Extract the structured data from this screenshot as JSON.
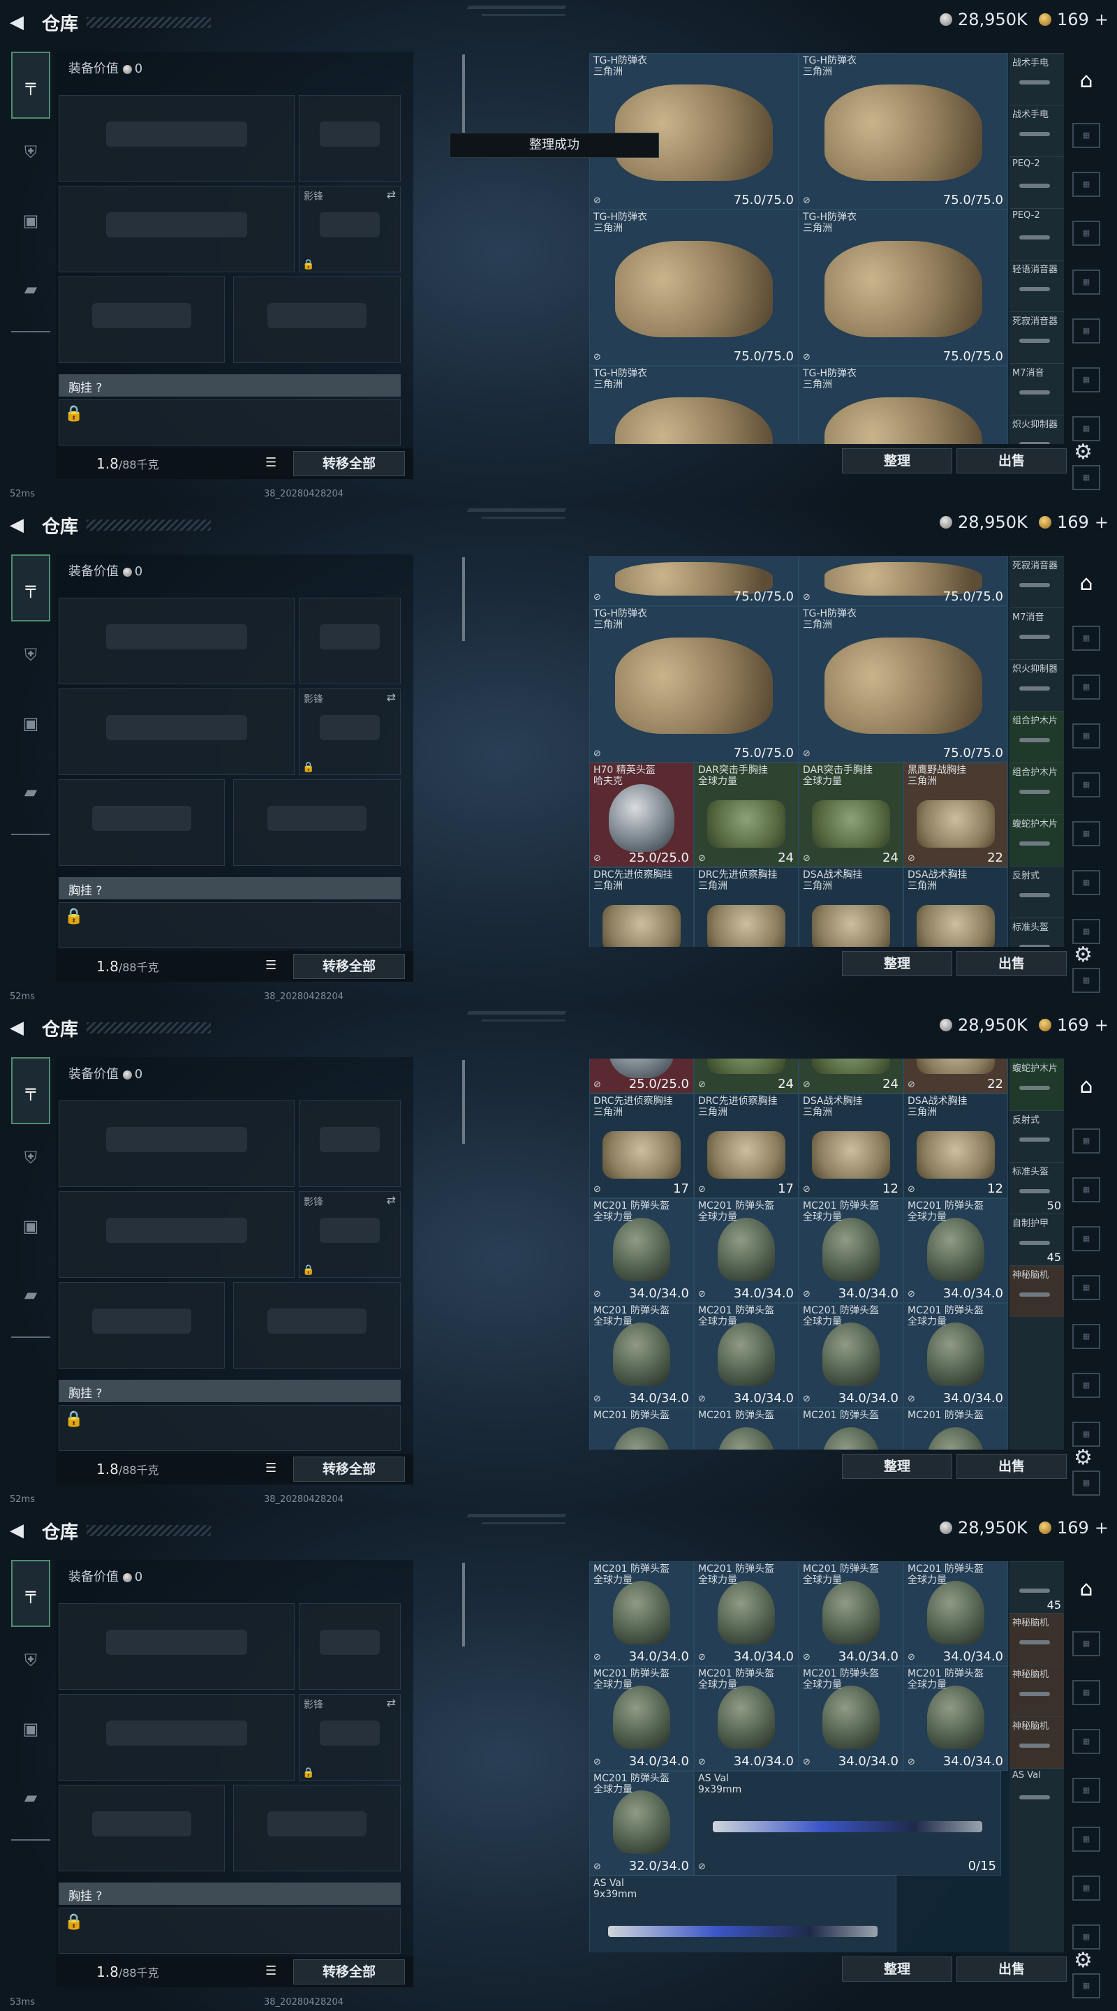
{
  "header": {
    "title": "仓库",
    "silver": "28,950K",
    "gold": "169",
    "gold_plus": "+"
  },
  "equipment": {
    "value_label": "装备价值",
    "value": "0",
    "secondary_slot_label": "影锋",
    "chest_label": "胸挂",
    "chest_help": "?",
    "weight": "1.8",
    "weight_max": "/88千克",
    "transfer_all": "转移全部"
  },
  "actions": {
    "sort": "整理",
    "sell": "出售"
  },
  "toast": "整理成功",
  "status": {
    "ping": "52ms",
    "ping_last": "53ms",
    "build": "38_20280428204"
  },
  "shots": [
    {
      "rows": [
        [
          {
            "name": "TG-H防弹衣",
            "sub": "三角洲",
            "val": "75.0/75.0",
            "type": "vest",
            "color": "blue",
            "w": 2
          },
          {
            "name": "TG-H防弹衣",
            "sub": "三角洲",
            "val": "75.0/75.0",
            "type": "vest",
            "color": "blue",
            "w": 2
          }
        ],
        [
          {
            "name": "TG-H防弹衣",
            "sub": "三角洲",
            "val": "75.0/75.0",
            "type": "vest",
            "color": "blue",
            "w": 2
          },
          {
            "name": "TG-H防弹衣",
            "sub": "三角洲",
            "val": "75.0/75.0",
            "type": "vest",
            "color": "blue",
            "w": 2
          }
        ],
        [
          {
            "name": "TG-H防弹衣",
            "sub": "三角洲",
            "val": "",
            "type": "vest",
            "color": "blue",
            "w": 2
          },
          {
            "name": "TG-H防弹衣",
            "sub": "三角洲",
            "val": "",
            "type": "vest",
            "color": "blue",
            "w": 2
          }
        ]
      ],
      "side": [
        "战术手电",
        "战术手电",
        "PEQ-2",
        "PEQ-2",
        "轻语消音器",
        "死寂消音器",
        "M7消音",
        "炽火抑制器"
      ],
      "side_colors": [
        "dark",
        "dark",
        "dark",
        "dark",
        "dark",
        "dark",
        "dark",
        "dark"
      ],
      "side_vals": [
        "",
        "",
        "",
        "",
        "",
        "",
        "",
        ""
      ]
    },
    {
      "rows": [
        [
          {
            "name": "",
            "sub": "",
            "val": "75.0/75.0",
            "type": "vest",
            "color": "blue",
            "w": 2
          },
          {
            "name": "",
            "sub": "",
            "val": "75.0/75.0",
            "type": "vest",
            "color": "blue",
            "w": 2
          }
        ],
        [
          {
            "name": "TG-H防弹衣",
            "sub": "三角洲",
            "val": "75.0/75.0",
            "type": "vest",
            "color": "blue",
            "w": 2
          },
          {
            "name": "TG-H防弹衣",
            "sub": "三角洲",
            "val": "75.0/75.0",
            "type": "vest",
            "color": "blue",
            "w": 2
          }
        ],
        [
          {
            "name": "H70 精英头盔",
            "sub": "哈夫克",
            "val": "25.0/25.0",
            "type": "helm2",
            "color": "red",
            "w": 1
          },
          {
            "name": "DAR突击手胸挂",
            "sub": "全球力量",
            "val": "24",
            "type": "rigg",
            "color": "green",
            "w": 1
          },
          {
            "name": "DAR突击手胸挂",
            "sub": "全球力量",
            "val": "24",
            "type": "rigg",
            "color": "green",
            "w": 1
          },
          {
            "name": "黑鹰野战胸挂",
            "sub": "三角洲",
            "val": "22",
            "type": "rig",
            "color": "brown",
            "w": 1
          }
        ],
        [
          {
            "name": "DRC先进侦察胸挂",
            "sub": "三角洲",
            "val": "",
            "type": "rig",
            "color": "dark",
            "w": 1
          },
          {
            "name": "DRC先进侦察胸挂",
            "sub": "三角洲",
            "val": "",
            "type": "rig",
            "color": "dark",
            "w": 1
          },
          {
            "name": "DSA战术胸挂",
            "sub": "三角洲",
            "val": "",
            "type": "rig",
            "color": "dark",
            "w": 1
          },
          {
            "name": "DSA战术胸挂",
            "sub": "三角洲",
            "val": "",
            "type": "rig",
            "color": "dark",
            "w": 1
          }
        ]
      ],
      "side": [
        "死寂消音器",
        "M7消音",
        "炽火抑制器",
        "组合护木片",
        "组合护木片",
        "蝮蛇护木片",
        "反射式",
        "标准头盔"
      ],
      "side_colors": [
        "dark",
        "dark",
        "dark",
        "green",
        "green",
        "green",
        "dark",
        "dark"
      ],
      "side_vals": [
        "",
        "",
        "",
        "",
        "",
        "",
        "",
        ""
      ]
    },
    {
      "rows": [
        [
          {
            "name": "",
            "sub": "",
            "val": "25.0/25.0",
            "type": "helm2",
            "color": "red",
            "w": 1
          },
          {
            "name": "",
            "sub": "",
            "val": "24",
            "type": "rigg",
            "color": "green",
            "w": 1
          },
          {
            "name": "",
            "sub": "",
            "val": "24",
            "type": "rigg",
            "color": "green",
            "w": 1
          },
          {
            "name": "",
            "sub": "",
            "val": "22",
            "type": "rig",
            "color": "brown",
            "w": 1
          }
        ],
        [
          {
            "name": "DRC先进侦察胸挂",
            "sub": "三角洲",
            "val": "17",
            "type": "rig",
            "color": "dark",
            "w": 1
          },
          {
            "name": "DRC先进侦察胸挂",
            "sub": "三角洲",
            "val": "17",
            "type": "rig",
            "color": "dark",
            "w": 1
          },
          {
            "name": "DSA战术胸挂",
            "sub": "三角洲",
            "val": "12",
            "type": "rig",
            "color": "dark",
            "w": 1
          },
          {
            "name": "DSA战术胸挂",
            "sub": "三角洲",
            "val": "12",
            "type": "rig",
            "color": "dark",
            "w": 1
          }
        ],
        [
          {
            "name": "MC201 防弹头盔",
            "sub": "全球力量",
            "val": "34.0/34.0",
            "type": "helm",
            "color": "blue",
            "w": 1
          },
          {
            "name": "MC201 防弹头盔",
            "sub": "全球力量",
            "val": "34.0/34.0",
            "type": "helm",
            "color": "blue",
            "w": 1
          },
          {
            "name": "MC201 防弹头盔",
            "sub": "全球力量",
            "val": "34.0/34.0",
            "type": "helm",
            "color": "blue",
            "w": 1
          },
          {
            "name": "MC201 防弹头盔",
            "sub": "全球力量",
            "val": "34.0/34.0",
            "type": "helm",
            "color": "blue",
            "w": 1
          }
        ],
        [
          {
            "name": "MC201 防弹头盔",
            "sub": "全球力量",
            "val": "34.0/34.0",
            "type": "helm",
            "color": "blue",
            "w": 1
          },
          {
            "name": "MC201 防弹头盔",
            "sub": "全球力量",
            "val": "34.0/34.0",
            "type": "helm",
            "color": "blue",
            "w": 1
          },
          {
            "name": "MC201 防弹头盔",
            "sub": "全球力量",
            "val": "34.0/34.0",
            "type": "helm",
            "color": "blue",
            "w": 1
          },
          {
            "name": "MC201 防弹头盔",
            "sub": "全球力量",
            "val": "34.0/34.0",
            "type": "helm",
            "color": "blue",
            "w": 1
          }
        ],
        [
          {
            "name": "MC201 防弹头盔",
            "sub": "",
            "val": "",
            "type": "helm",
            "color": "blue",
            "w": 1
          },
          {
            "name": "MC201 防弹头盔",
            "sub": "",
            "val": "",
            "type": "helm",
            "color": "blue",
            "w": 1
          },
          {
            "name": "MC201 防弹头盔",
            "sub": "",
            "val": "",
            "type": "helm",
            "color": "blue",
            "w": 1
          },
          {
            "name": "MC201 防弹头盔",
            "sub": "",
            "val": "",
            "type": "helm",
            "color": "blue",
            "w": 1
          }
        ]
      ],
      "side": [
        "蝮蛇护木片",
        "反射式",
        "标准头盔",
        "自制护甲",
        "神秘脑机"
      ],
      "side_colors": [
        "green",
        "dark",
        "dark",
        "dark",
        "brown"
      ],
      "side_vals": [
        "",
        "",
        "50",
        "45",
        ""
      ]
    },
    {
      "rows": [
        [
          {
            "name": "MC201 防弹头盔",
            "sub": "全球力量",
            "val": "34.0/34.0",
            "type": "helm",
            "color": "blue",
            "w": 1
          },
          {
            "name": "MC201 防弹头盔",
            "sub": "全球力量",
            "val": "34.0/34.0",
            "type": "helm",
            "color": "blue",
            "w": 1
          },
          {
            "name": "MC201 防弹头盔",
            "sub": "全球力量",
            "val": "34.0/34.0",
            "type": "helm",
            "color": "blue",
            "w": 1
          },
          {
            "name": "MC201 防弹头盔",
            "sub": "全球力量",
            "val": "34.0/34.0",
            "type": "helm",
            "color": "blue",
            "w": 1
          }
        ],
        [
          {
            "name": "MC201 防弹头盔",
            "sub": "全球力量",
            "val": "34.0/34.0",
            "type": "helm",
            "color": "blue",
            "w": 1
          },
          {
            "name": "MC201 防弹头盔",
            "sub": "全球力量",
            "val": "34.0/34.0",
            "type": "helm",
            "color": "blue",
            "w": 1
          },
          {
            "name": "MC201 防弹头盔",
            "sub": "全球力量",
            "val": "34.0/34.0",
            "type": "helm",
            "color": "blue",
            "w": 1
          },
          {
            "name": "MC201 防弹头盔",
            "sub": "全球力量",
            "val": "34.0/34.0",
            "type": "helm",
            "color": "blue",
            "w": 1
          }
        ],
        [
          {
            "name": "MC201 防弹头盔",
            "sub": "全球力量",
            "val": "32.0/34.0",
            "type": "helm",
            "color": "blue",
            "w": 1
          },
          {
            "name": "AS Val",
            "sub": "9x39mm",
            "val": "0/15",
            "type": "gun",
            "color": "dark",
            "w": 3
          }
        ],
        [
          {
            "name": "AS Val",
            "sub": "9x39mm",
            "val": "",
            "type": "gun",
            "color": "dark",
            "w": 3
          }
        ]
      ],
      "side": [
        "",
        "神秘脑机",
        "神秘脑机",
        "神秘脑机",
        "AS Val"
      ],
      "side_colors": [
        "dark",
        "brown",
        "brown",
        "brown",
        "dark"
      ],
      "side_vals": [
        "45",
        "",
        "",
        "",
        ""
      ]
    }
  ]
}
